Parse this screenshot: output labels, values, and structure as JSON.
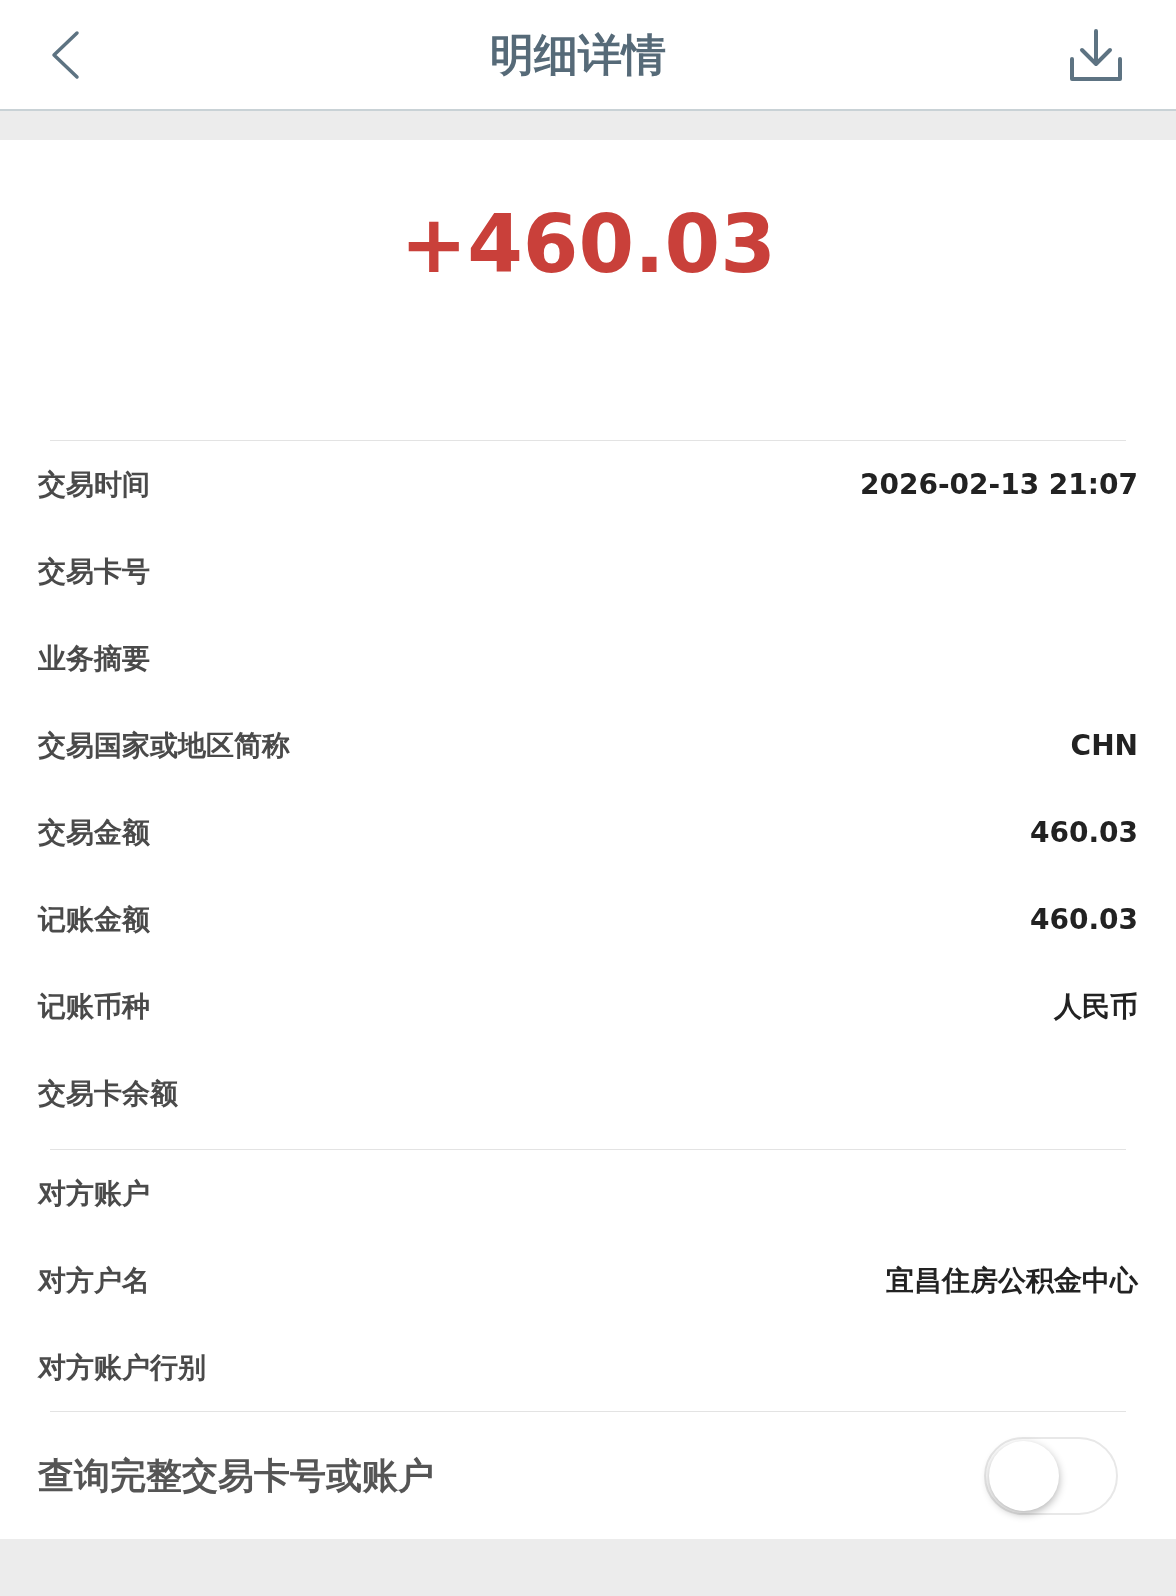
{
  "header": {
    "title": "明细详情"
  },
  "amount": "+460.03",
  "sections": [
    {
      "rows": [
        {
          "label": "交易时间",
          "value": "2026-02-13 21:07"
        },
        {
          "label": "交易卡号"
        },
        {
          "label": "业务摘要"
        },
        {
          "label": "交易国家或地区简称",
          "value": "CHN"
        },
        {
          "label": "交易金额",
          "value": "460.03"
        },
        {
          "label": "记账金额",
          "value": "460.03"
        },
        {
          "label": "记账币种",
          "value": "人民币"
        },
        {
          "label": "交易卡余额"
        }
      ]
    },
    {
      "rows": [
        {
          "label": "对方账户"
        },
        {
          "label": "对方户名",
          "value": "宜昌住房公积金中心"
        },
        {
          "label": "对方账户行别"
        }
      ]
    }
  ],
  "toggle": {
    "label": "查询完整交易卡号或账户",
    "on": false
  }
}
